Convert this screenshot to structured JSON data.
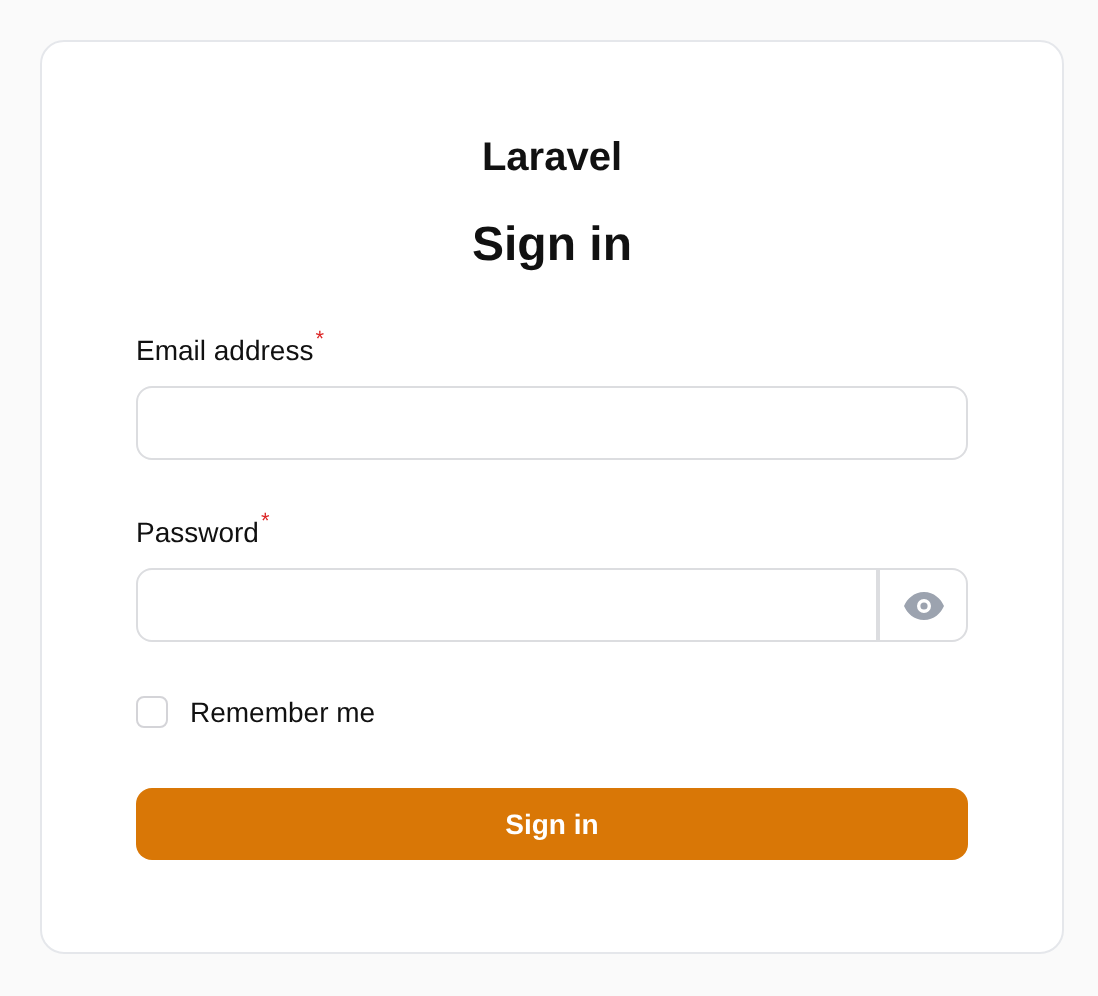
{
  "brand": "Laravel",
  "heading": "Sign in",
  "fields": [
    {
      "kind": "email",
      "label": "Email address",
      "required_mark": "*"
    },
    {
      "kind": "password",
      "label": "Password",
      "required_mark": "*"
    }
  ],
  "remember": {
    "label": "Remember me",
    "checked": false
  },
  "submit": "Sign in"
}
